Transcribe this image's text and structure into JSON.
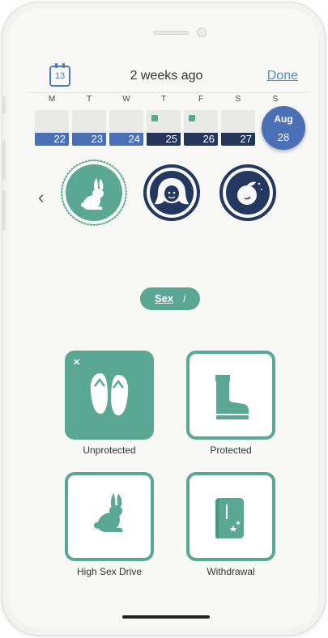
{
  "header": {
    "calendar_day": "13",
    "title": "2 weeks ago",
    "done_label": "Done"
  },
  "week": {
    "days": [
      {
        "letter": "M",
        "date": "22",
        "style": "blue",
        "logged": false
      },
      {
        "letter": "T",
        "date": "23",
        "style": "blue",
        "logged": false
      },
      {
        "letter": "W",
        "date": "24",
        "style": "blue",
        "logged": false
      },
      {
        "letter": "T",
        "date": "25",
        "style": "dark",
        "logged": true
      },
      {
        "letter": "F",
        "date": "26",
        "style": "dark",
        "logged": true
      },
      {
        "letter": "S",
        "date": "27",
        "style": "dark",
        "logged": false
      },
      {
        "letter": "S",
        "date": "28",
        "style": "today",
        "logged": false
      }
    ],
    "selected": {
      "month": "Aug",
      "date": "28"
    }
  },
  "categories": [
    "sex-icon",
    "hair-icon",
    "peach-icon"
  ],
  "section": {
    "label": "Sex",
    "info": "i"
  },
  "options": [
    {
      "label": "Unprotected",
      "icon": "flip-flops-icon",
      "active": true
    },
    {
      "label": "Protected",
      "icon": "rain-boot-icon",
      "active": false
    },
    {
      "label": "High Sex Drive",
      "icon": "rabbit-icon",
      "active": false
    },
    {
      "label": "Withdrawal",
      "icon": "book-icon",
      "active": false
    }
  ],
  "colors": {
    "accent": "#5aa894",
    "blue": "#4c70b5",
    "navy": "#24385f"
  }
}
